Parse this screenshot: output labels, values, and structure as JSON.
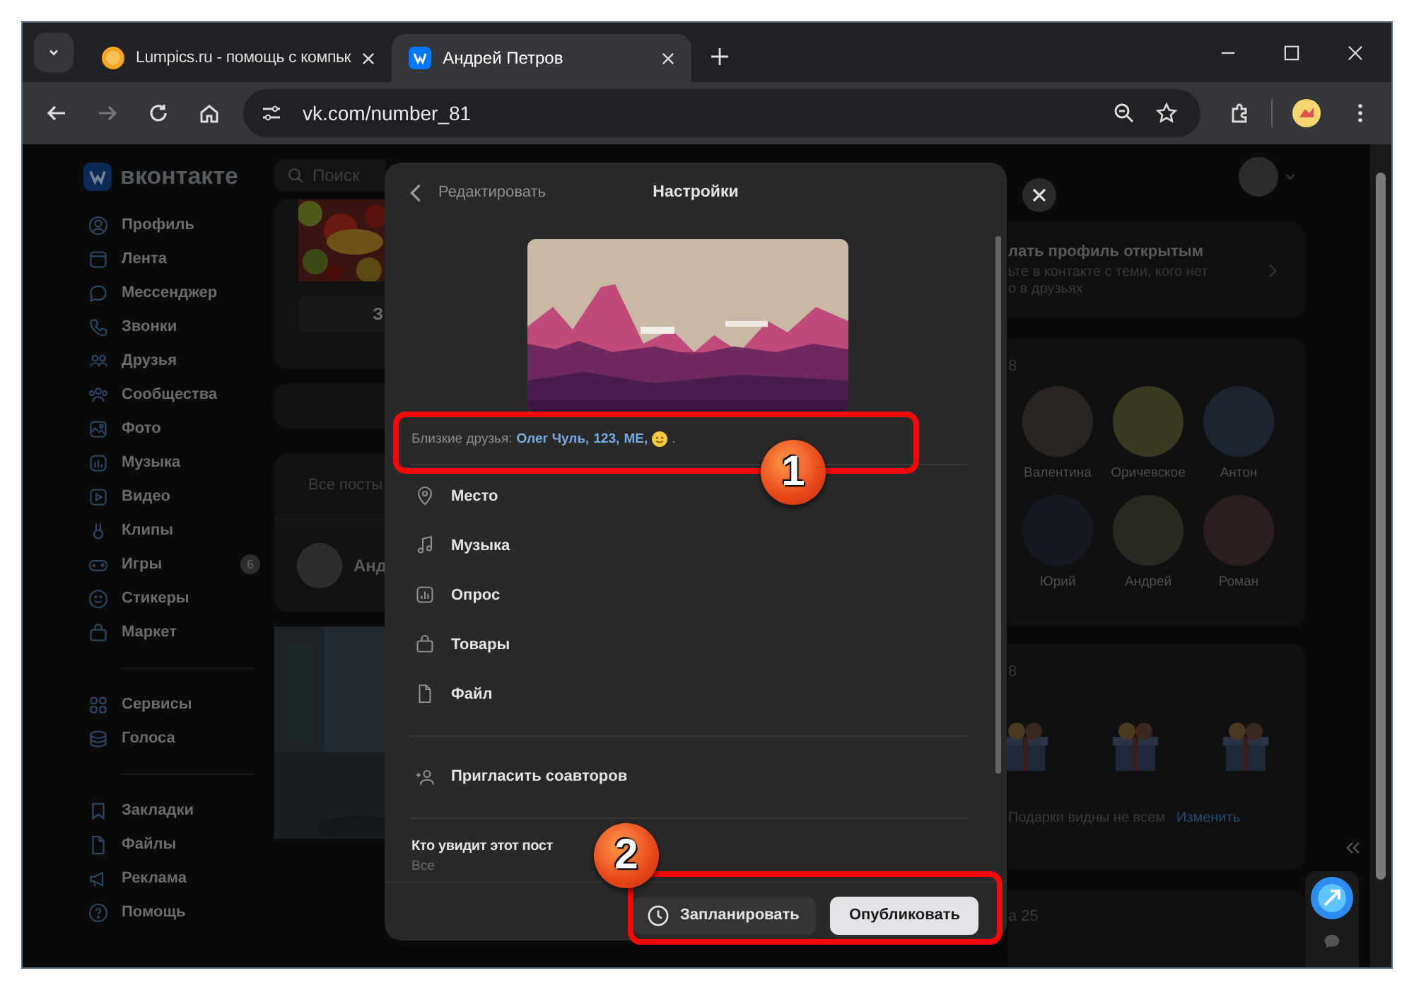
{
  "browser": {
    "tabs": [
      {
        "title": "Lumpics.ru - помощь с компьк",
        "selected": false
      },
      {
        "title": "Андрей Петров",
        "selected": true
      }
    ],
    "url": "vk.com/number_81"
  },
  "sidebar": {
    "logo": "вконтакте",
    "groups": [
      [
        {
          "label": "Профиль"
        },
        {
          "label": "Лента"
        },
        {
          "label": "Мессенджер"
        },
        {
          "label": "Звонки"
        },
        {
          "label": "Друзья"
        },
        {
          "label": "Сообщества"
        },
        {
          "label": "Фото"
        },
        {
          "label": "Музыка"
        },
        {
          "label": "Видео"
        },
        {
          "label": "Клипы"
        },
        {
          "label": "Игры",
          "badge": "6"
        },
        {
          "label": "Стикеры"
        },
        {
          "label": "Маркет"
        }
      ],
      [
        {
          "label": "Сервисы"
        },
        {
          "label": "Голоса"
        }
      ],
      [
        {
          "label": "Закладки"
        },
        {
          "label": "Файлы"
        },
        {
          "label": "Реклама"
        },
        {
          "label": "Помощь"
        }
      ]
    ]
  },
  "feed": {
    "search_placeholder": "Поиск",
    "photo_button": "З",
    "posts_tab": "Все посты",
    "author": "Анд"
  },
  "right": {
    "promo_title": "лать профиль открытым",
    "promo_lines": [
      "ьте в контакте с теми, кого нет",
      "о в друзьях"
    ],
    "friends_count": "8",
    "friends": [
      "Валентина",
      "Оричевское",
      "Антон",
      "Юрий",
      "Андрей",
      "Роман"
    ],
    "gifts_count": "8",
    "gifts_note": "Подарки видны не всем",
    "gifts_link": "Изменить",
    "next_count": "а 25"
  },
  "modal": {
    "back": "Редактировать",
    "title": "Настройки",
    "close_friends": {
      "label": "Близкие друзья:",
      "names": [
        "Олег Чуль,",
        "123,",
        "МЕ,"
      ],
      "end": "."
    },
    "options": [
      {
        "label": "Место"
      },
      {
        "label": "Музыка"
      },
      {
        "label": "Опрос"
      },
      {
        "label": "Товары"
      },
      {
        "label": "Файл"
      }
    ],
    "invite": "Пригласить соавторов",
    "visibility": {
      "title": "Кто увидит этот пост",
      "value": "Все"
    },
    "schedule": "Запланировать",
    "publish": "Опубликовать"
  },
  "annotations": [
    "1",
    "2"
  ]
}
